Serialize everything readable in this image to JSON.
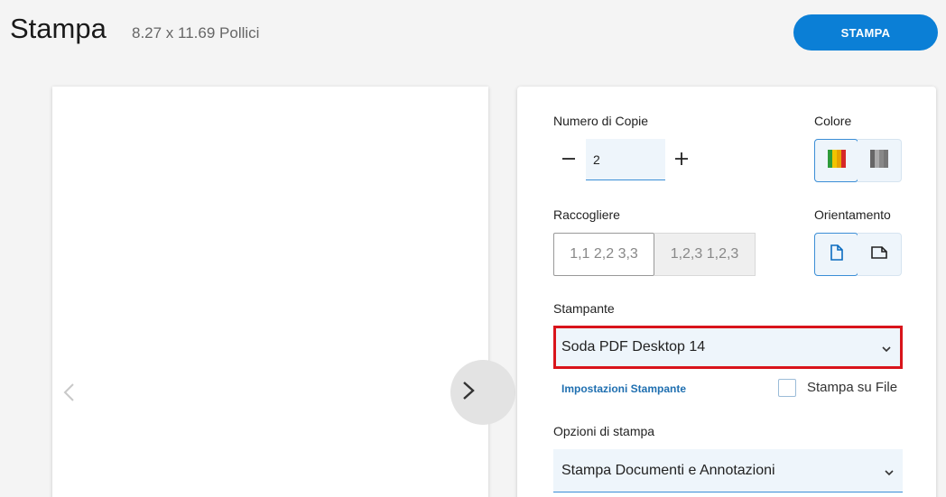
{
  "header": {
    "title": "Stampa",
    "paper_size": "8.27 x 11.69 Pollici",
    "print_button_label": "STAMPA"
  },
  "preview": {
    "prev_icon": "chevron-left-icon",
    "next_icon": "chevron-right-icon"
  },
  "settings": {
    "copies": {
      "label": "Numero di Copie",
      "value": "2",
      "decrement_icon": "minus-icon",
      "increment_icon": "plus-icon"
    },
    "color": {
      "label": "Colore",
      "options": [
        "color-icon",
        "grayscale-icon"
      ],
      "selected": "color"
    },
    "collate": {
      "label": "Raccogliere",
      "options": [
        "1,1 2,2 3,3",
        "1,2,3 1,2,3"
      ],
      "selected": "1,1 2,2 3,3"
    },
    "orientation": {
      "label": "Orientamento",
      "options": [
        "portrait-icon",
        "landscape-icon"
      ],
      "selected": "portrait"
    },
    "printer": {
      "label": "Stampante",
      "value": "Soda PDF Desktop 14",
      "settings_link": "Impostazioni Stampante",
      "print_to_file_label": "Stampa su File",
      "print_to_file_checked": false
    },
    "print_options": {
      "label": "Opzioni di stampa",
      "value": "Stampa Documenti e Annotazioni"
    }
  },
  "colors": {
    "accent": "#0b7fd6",
    "highlight_border": "#d9141b",
    "field_bg": "#eef5fb"
  }
}
